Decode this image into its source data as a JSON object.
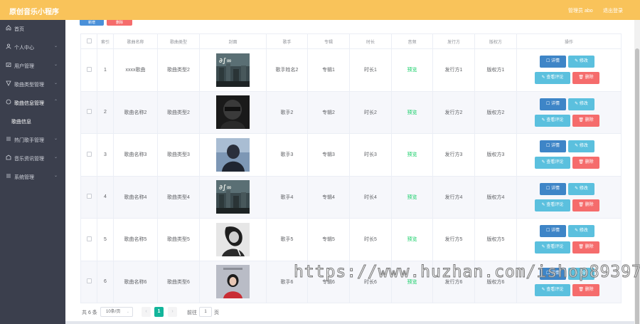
{
  "header": {
    "title": "原创音乐小程序",
    "admin": "管理员 abo",
    "logout": "退出登录"
  },
  "sidebar": {
    "items": [
      {
        "label": "首页",
        "icon": "home-icon",
        "has_arrow": false
      },
      {
        "label": "个人中心",
        "icon": "user-icon",
        "has_arrow": true
      },
      {
        "label": "用户管理",
        "icon": "users-icon",
        "has_arrow": true
      },
      {
        "label": "歌曲类型管理",
        "icon": "tag-icon",
        "has_arrow": true
      },
      {
        "label": "歌曲信息管理",
        "icon": "music-icon",
        "has_arrow": true
      },
      {
        "label": "歌曲信息",
        "icon": "",
        "has_arrow": false,
        "sub": true
      },
      {
        "label": "热门歌手管理",
        "icon": "star-icon",
        "has_arrow": true
      },
      {
        "label": "音乐资讯管理",
        "icon": "news-icon",
        "has_arrow": true
      },
      {
        "label": "系统管理",
        "icon": "settings-icon",
        "has_arrow": true
      }
    ]
  },
  "toolbar": {
    "add_label": "新增",
    "delete_label": "删除"
  },
  "table": {
    "headers": [
      "",
      "索引",
      "歌曲名称",
      "歌曲类型",
      "封面",
      "歌手",
      "专辑",
      "时长",
      "音频",
      "发行方",
      "版权方",
      "操作"
    ],
    "rows": [
      {
        "index": "1",
        "name": "xxxx歌曲",
        "type": "歌曲类型2",
        "singer": "歌手姓名2",
        "album": "专辑1",
        "duration": "时长1",
        "audio": "预览",
        "publisher": "发行方1",
        "copyright": "版权方1",
        "cover": "city-cover"
      },
      {
        "index": "2",
        "name": "歌曲名称2",
        "type": "歌曲类型2",
        "singer": "歌手2",
        "album": "专辑2",
        "duration": "时长2",
        "audio": "预览",
        "publisher": "发行方2",
        "copyright": "版权方2",
        "cover": "dark-portrait-cover"
      },
      {
        "index": "3",
        "name": "歌曲名称3",
        "type": "歌曲类型3",
        "singer": "歌手3",
        "album": "专辑3",
        "duration": "时长3",
        "audio": "预览",
        "publisher": "发行方3",
        "copyright": "版权方3",
        "cover": "blue-portrait-cover"
      },
      {
        "index": "4",
        "name": "歌曲名称4",
        "type": "歌曲类型4",
        "singer": "歌手4",
        "album": "专辑4",
        "duration": "时长4",
        "audio": "预览",
        "publisher": "发行方4",
        "copyright": "版权方4",
        "cover": "city-cover"
      },
      {
        "index": "5",
        "name": "歌曲名称5",
        "type": "歌曲类型5",
        "singer": "歌手5",
        "album": "专辑5",
        "duration": "时长5",
        "audio": "预览",
        "publisher": "发行方5",
        "copyright": "版权方5",
        "cover": "bw-portrait-cover"
      },
      {
        "index": "6",
        "name": "歌曲名称6",
        "type": "歌曲类型6",
        "singer": "歌手6",
        "album": "专辑6",
        "duration": "时长6",
        "audio": "预览",
        "publisher": "发行方6",
        "copyright": "版权方6",
        "cover": "red-portrait-cover"
      }
    ],
    "actions": {
      "detail": "详情",
      "edit": "修改",
      "comments": "查看评论",
      "delete": "删除"
    }
  },
  "pagination": {
    "total": "共 6 条",
    "page_size": "10条/页",
    "current_page": "1",
    "goto_label": "前往",
    "goto_value": "1",
    "goto_suffix": "页"
  },
  "watermark": "https://www.huzhan.com/ishop89397",
  "colors": {
    "header": "#f9c35a",
    "sidebar": "#3b3f4d",
    "primary": "#3e85c7",
    "info": "#5bc0de",
    "danger": "#f56c6c",
    "preview": "#13ce66",
    "pager_active": "#13b59b"
  }
}
